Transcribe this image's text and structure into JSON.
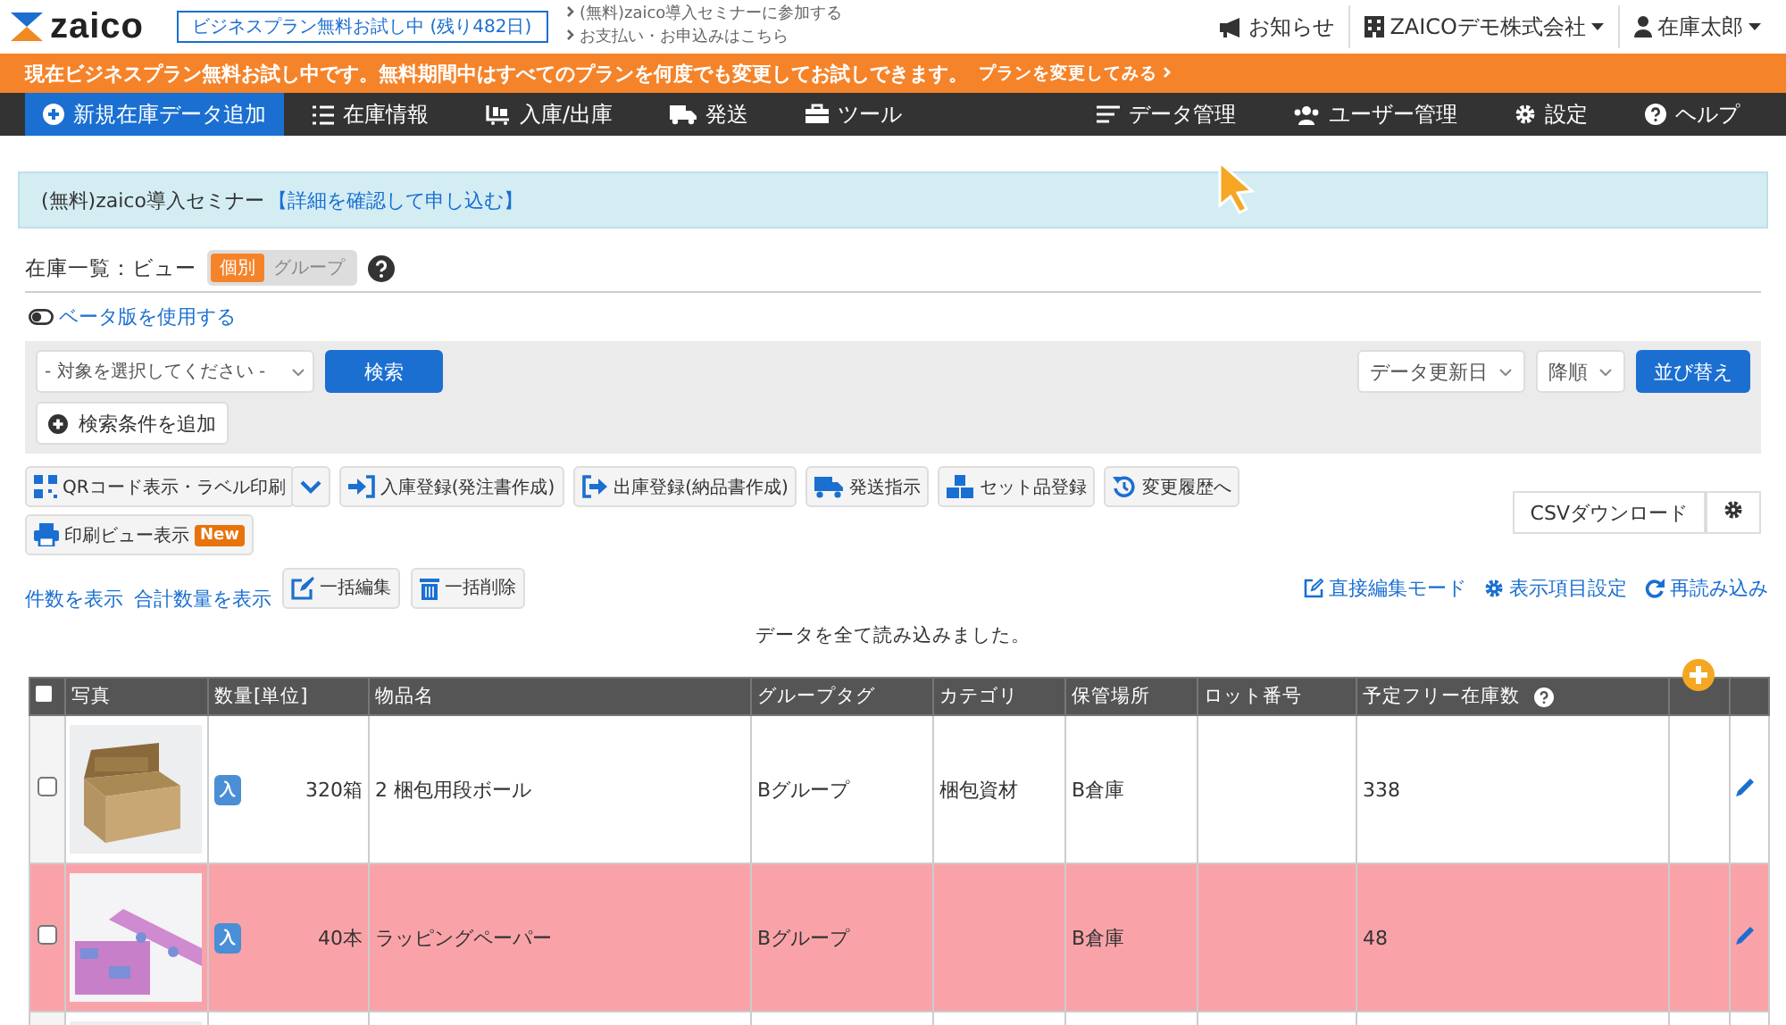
{
  "header": {
    "logo": "zaico",
    "trial_badge": "ビジネスプラン無料お試し中 (残り482日)",
    "links": [
      "(無料)zaico導入セミナーに参加する",
      "お支払い・お申込みはこちら"
    ],
    "notices": "お知らせ",
    "company": "ZAICOデモ株式会社",
    "user": "在庫太郎"
  },
  "promo_bar": {
    "text": "現在ビジネスプラン無料お試し中です。無料期間中はすべてのプランを何度でも変更してお試しできます。",
    "link": "プランを変更してみる"
  },
  "nav": {
    "left": [
      {
        "label": "新規在庫データ追加",
        "selected": true
      },
      {
        "label": "在庫情報",
        "selected": false
      },
      {
        "label": "入庫/出庫",
        "selected": false
      },
      {
        "label": "発送",
        "selected": false
      },
      {
        "label": "ツール",
        "selected": false
      }
    ],
    "right": [
      "データ管理",
      "ユーザー管理",
      "設定",
      "ヘルプ"
    ]
  },
  "seminar_banner": {
    "text": "(無料)zaico導入セミナー",
    "link": "【詳細を確認して申し込む】"
  },
  "view": {
    "label": "在庫一覧：ビュー",
    "options": [
      {
        "label": "個別",
        "selected": true
      },
      {
        "label": "グループ",
        "selected": false
      }
    ]
  },
  "beta_toggle": {
    "label": "ベータ版を使用する",
    "on": false
  },
  "search": {
    "target_select": "- 対象を選択してください -",
    "search_button": "検索",
    "add_condition": "検索条件を追加",
    "sort_field": "データ更新日",
    "sort_order": "降順",
    "sort_button": "並び替え"
  },
  "actions": [
    {
      "label": "QRコード表示・ラベル印刷"
    },
    {
      "label": "入庫登録(発注書作成)"
    },
    {
      "label": "出庫登録(納品書作成)"
    },
    {
      "label": "発送指示"
    },
    {
      "label": "セット品登録"
    },
    {
      "label": "変更履歴へ"
    },
    {
      "label": "印刷ビュー表示",
      "badge": "New"
    }
  ],
  "csv_button": "CSVダウンロード",
  "count_links": [
    "件数を表示",
    "合計数量を表示"
  ],
  "bulk_actions": [
    "一括編集",
    "一括削除"
  ],
  "view_links": [
    "直接編集モード",
    "表示項目設定",
    "再読み込み"
  ],
  "load_message": "データを全て読み込みました。",
  "table": {
    "select_all_checked": false,
    "columns": [
      "写真",
      "数量[単位]",
      "物品名",
      "グループタグ",
      "カテゴリ",
      "保管場所",
      "ロット番号",
      "予定フリー在庫数"
    ],
    "rows": [
      {
        "checked": false,
        "alert": false,
        "badge": "入",
        "quantity": "320箱",
        "name": "2 梱包用段ボール",
        "group_tag": "Bグループ",
        "category": "梱包資材",
        "location": "B倉庫",
        "free_stock": "338"
      },
      {
        "checked": false,
        "alert": true,
        "badge": "入",
        "quantity": "40本",
        "name": "ラッピングペーパー",
        "group_tag": "Bグループ",
        "location": "B倉庫",
        "free_stock": "48"
      },
      {
        "alert": false
      }
    ]
  }
}
